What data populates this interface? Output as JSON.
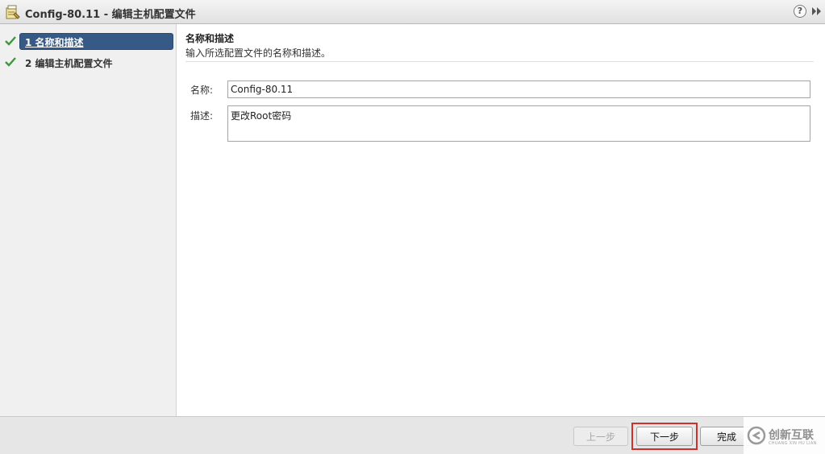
{
  "window": {
    "title": "Config-80.11 - 编辑主机配置文件",
    "help_label": "?"
  },
  "sidebar": {
    "steps": [
      {
        "number": "1",
        "label": "1 名称和描述",
        "status": "completed",
        "active": true
      },
      {
        "number": "2",
        "label": "2 编辑主机配置文件",
        "status": "completed",
        "active": false
      }
    ]
  },
  "main": {
    "section_title": "名称和描述",
    "section_description": "输入所选配置文件的名称和描述。",
    "fields": {
      "name_label": "名称:",
      "name_value": "Config-80.11",
      "description_label": "描述:",
      "description_value": "更改Root密码"
    }
  },
  "footer": {
    "back_label": "上一步",
    "next_label": "下一步",
    "finish_label": "完成",
    "back_disabled": true
  },
  "watermark": {
    "text": "创新互联",
    "subtext": "CHUANG XIN HU LIAN"
  },
  "colors": {
    "active_step": "#365a85",
    "check": "#3a9a3a",
    "highlight_border": "#d0302a"
  }
}
